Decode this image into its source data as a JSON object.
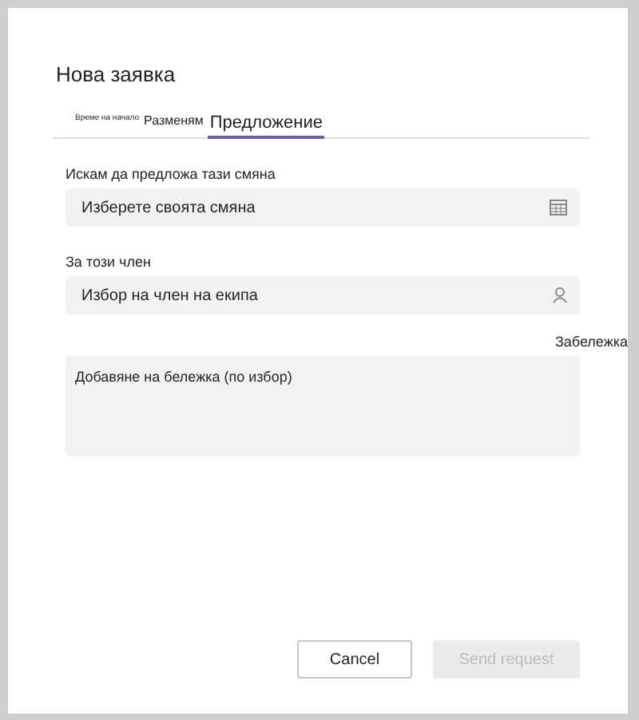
{
  "dialog": {
    "title": "Нова заявка"
  },
  "tabs": [
    {
      "label": "Време на начало",
      "selected": false
    },
    {
      "label": "Разменям",
      "selected": false
    },
    {
      "label": "Предложение",
      "selected": true
    }
  ],
  "fields": [
    {
      "label": "Искам да предложа тази смяна",
      "placeholder": "Изберете своята смяна"
    },
    {
      "label": "За този член",
      "placeholder": "Избор на член на екипа"
    }
  ],
  "note": {
    "label": "Забележка",
    "placeholder": "Добавяне на бележка (по избор)"
  },
  "buttons": [
    {
      "label": "Cancel",
      "disabled": false
    },
    {
      "label": "Send request",
      "disabled": true
    }
  ]
}
